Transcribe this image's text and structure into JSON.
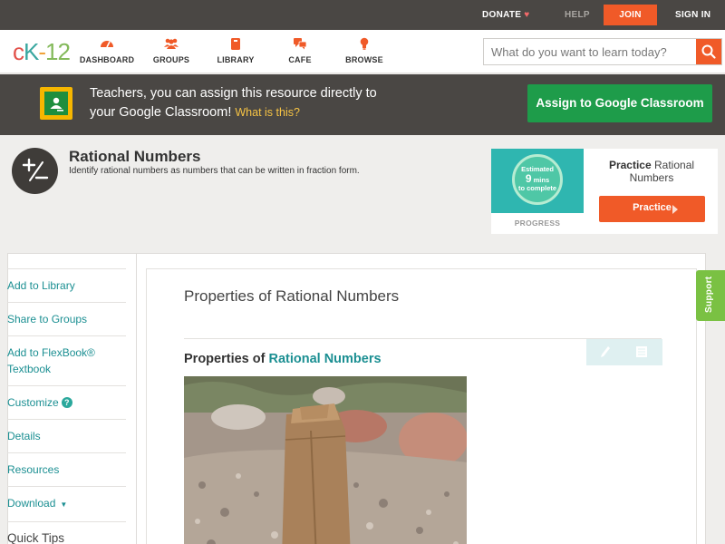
{
  "topbar": {
    "donate": "DONATE",
    "help": "HELP",
    "join": "JOIN",
    "signin": "SIGN IN"
  },
  "logo": {
    "c": "c",
    "k": "K",
    "dash": "-",
    "num": "12"
  },
  "nav": {
    "dashboard": "DASHBOARD",
    "groups": "GROUPS",
    "library": "LIBRARY",
    "cafe": "CAFE",
    "browse": "BROWSE"
  },
  "search": {
    "placeholder": "What do you want to learn today?"
  },
  "banner": {
    "line1": "Teachers, you can assign this resource directly to",
    "line2": "your Google Classroom!",
    "what": "What is this?",
    "assign": "Assign to Google Classroom"
  },
  "concept": {
    "title": "Rational Numbers",
    "description": "Identify rational numbers as numbers that can be written in fraction form."
  },
  "practice": {
    "est1": "Estimated",
    "est2": "9",
    "est3": "mins",
    "est4": "to complete",
    "progress": "PROGRESS",
    "title_bold": "Practice",
    "title_rest": "Rational Numbers",
    "button": "Practice"
  },
  "sidebar": {
    "items": [
      {
        "label": "Add to Library"
      },
      {
        "label": "Share to Groups"
      },
      {
        "label": "Add to FlexBook® Textbook"
      },
      {
        "label": "Customize"
      },
      {
        "label": "Details"
      },
      {
        "label": "Resources"
      },
      {
        "label": "Download"
      },
      {
        "label": "Quick Tips"
      }
    ]
  },
  "article": {
    "title": "Properties of Rational Numbers",
    "section_prefix": "Properties of",
    "section_link": "Rational Numbers"
  },
  "support": "Support",
  "colors": {
    "brand_orange": "#f05a28",
    "google_green": "#1e9c4a",
    "link_teal": "#1b8f92",
    "support_green": "#7ac143",
    "dark_bar": "#4a4744"
  },
  "icons": {
    "dashboard": "speedometer-icon",
    "groups": "people-icon",
    "library": "book-icon",
    "cafe": "chat-bubbles-icon",
    "browse": "lightbulb-icon",
    "search": "search-icon",
    "concept": "plus-minus-icon"
  }
}
